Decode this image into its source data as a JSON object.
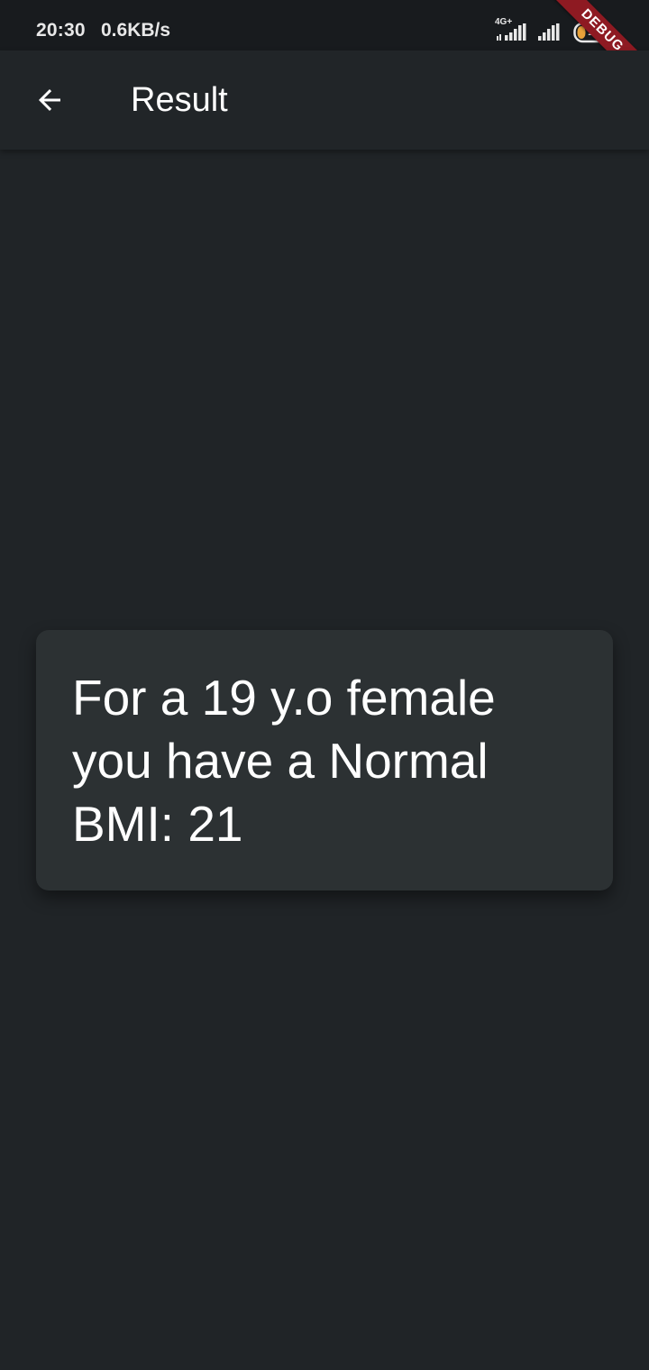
{
  "status_bar": {
    "time": "20:30",
    "speed": "0.6KB/s",
    "network_type": "4G+",
    "battery_level": "18"
  },
  "debug_banner": {
    "label": "DEBUG",
    "color": "#8e1a22"
  },
  "app_bar": {
    "back_icon": "arrow-back-icon",
    "title": "Result"
  },
  "result_card": {
    "text": "For a 19 y.o female you have a Normal BMI: 21"
  },
  "colors": {
    "background": "#202427",
    "card": "#2c3133",
    "text": "#ffffff"
  }
}
